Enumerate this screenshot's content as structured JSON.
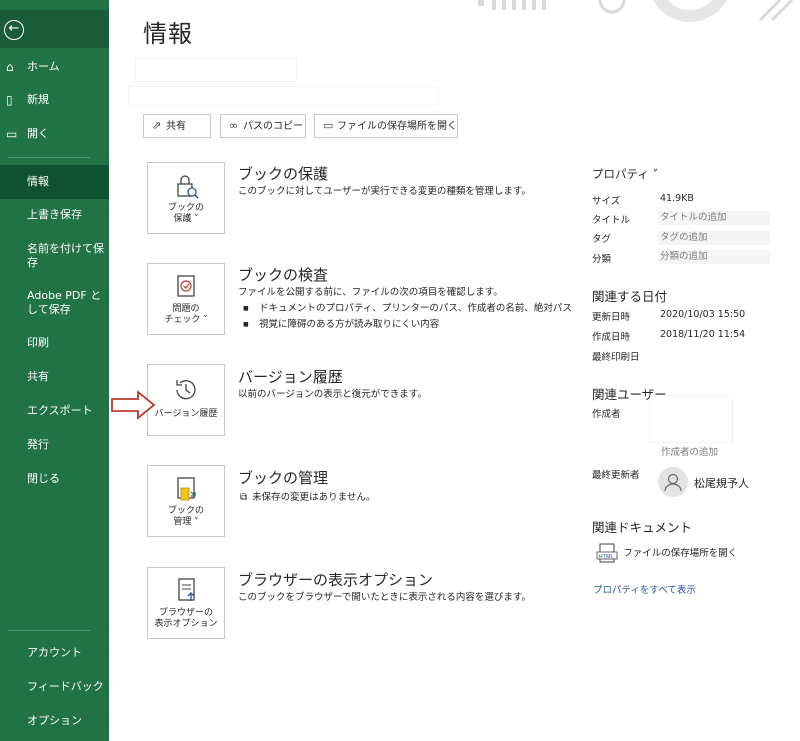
{
  "sidebar": {
    "back_icon": "arrow-left-circle-icon",
    "items": [
      {
        "icon": "home-icon",
        "label": "ホーム"
      },
      {
        "icon": "new-doc-icon",
        "label": "新規"
      },
      {
        "icon": "folder-open-icon",
        "label": "開く"
      }
    ],
    "menu": [
      "情報",
      "上書き保存",
      "名前を付けて保存",
      "Adobe PDF として保存",
      "印刷",
      "共有",
      "エクスポート",
      "発行",
      "閉じる"
    ],
    "selected": "情報",
    "bottom": [
      "アカウント",
      "フィードバック",
      "オプション"
    ]
  },
  "page": {
    "title": "情報"
  },
  "toolbar": {
    "share": "共有",
    "copy_path": "パスのコピー",
    "open_location": "ファイルの保存場所を開く"
  },
  "sections": [
    {
      "card": [
        "ブックの",
        "保護 ˅"
      ],
      "title": "ブックの保護",
      "desc": "このブックに対してユーザーが実行できる変更の種類を管理します。",
      "bullets": []
    },
    {
      "card": [
        "問題の",
        "チェック ˅"
      ],
      "title": "ブックの検査",
      "desc": "ファイルを公開する前に、ファイルの次の項目を確認します。",
      "bullets": [
        "ドキュメントのプロパティ、プリンターのパス、作成者の名前、絶対パス",
        "視覚に障碍のある方が読み取りにくい内容"
      ]
    },
    {
      "card": [
        "バージョン履歴"
      ],
      "title": "バージョン履歴",
      "desc": "以前のバージョンの表示と復元ができます。",
      "bullets": []
    },
    {
      "card": [
        "ブックの",
        "管理 ˅"
      ],
      "title": "ブックの管理",
      "desc": "未保存の変更はありません。",
      "bullets": []
    },
    {
      "card": [
        "ブラウザーの",
        "表示オプション"
      ],
      "title": "ブラウザーの表示オプション",
      "desc": "このブックをブラウザーで開いたときに表示される内容を選びます。",
      "bullets": []
    }
  ],
  "properties": {
    "header": "プロパティ ˅",
    "size_label": "サイズ",
    "size_value": "41.9KB",
    "title_label": "タイトル",
    "title_placeholder": "タイトルの追加",
    "tag_label": "タグ",
    "tag_placeholder": "タグの追加",
    "category_label": "分類",
    "category_placeholder": "分類の追加"
  },
  "dates": {
    "header": "関連する日付",
    "updated_label": "更新日時",
    "updated_value": "2020/10/03 15:50",
    "created_label": "作成日時",
    "created_value": "2018/11/20 11:54",
    "printed_label": "最終印刷日"
  },
  "users": {
    "header": "関連ユーザー",
    "author_label": "作成者",
    "add_author": "作成者の追加",
    "last_modified_label": "最終更新者",
    "last_modified_name": "松尾規予人"
  },
  "documents": {
    "header": "関連ドキュメント",
    "open_location": "ファイルの保存場所を開く",
    "show_all": "プロパティをすべて表示"
  },
  "colors": {
    "sidebar": "#217346",
    "sidebar_selected": "#0f5230",
    "link": "#2b579a",
    "arrow": "#c0392b"
  }
}
